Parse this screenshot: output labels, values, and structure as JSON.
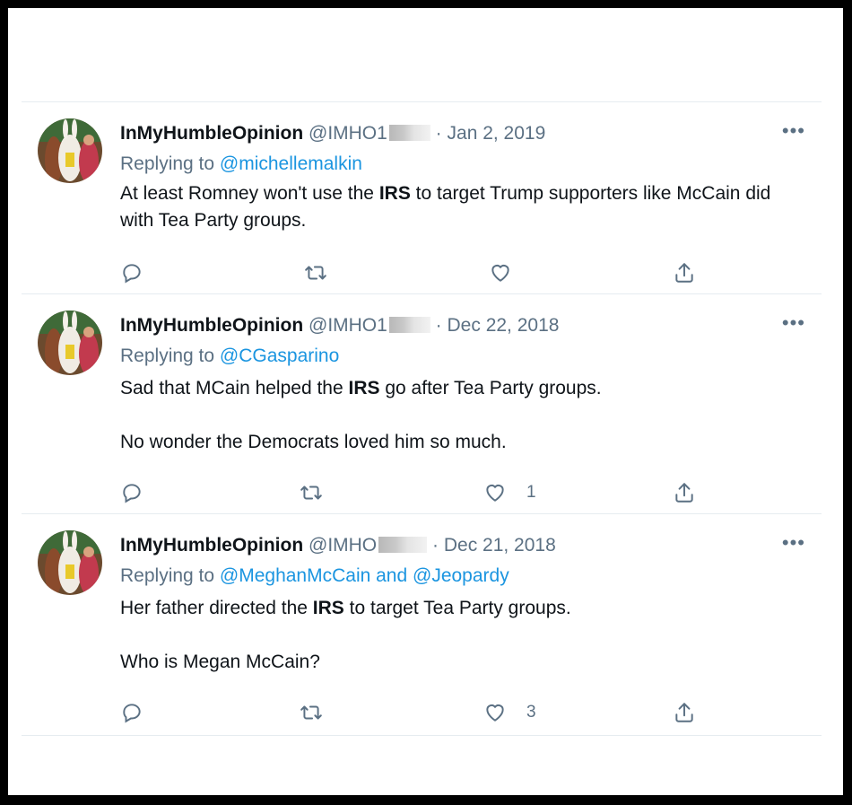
{
  "tweets": [
    {
      "name": "InMyHumbleOpinion",
      "handle": "@IMHO1",
      "separator": "·",
      "date": "Jan 2, 2019",
      "replying_prefix": "Replying to",
      "replying_to": "@michellemalkin",
      "body": [
        {
          "pre": "At least Romney won't use the ",
          "bold": "IRS",
          "post": " to target Trump supporters like McCain did with Tea Party groups."
        }
      ],
      "likes": ""
    },
    {
      "name": "InMyHumbleOpinion",
      "handle": "@IMHO1",
      "separator": "·",
      "date": "Dec 22, 2018",
      "replying_prefix": "Replying to",
      "replying_to": "@CGasparino",
      "body": [
        {
          "pre": "Sad that MCain helped the ",
          "bold": "IRS",
          "post": " go after Tea Party groups."
        },
        {
          "pre": "No wonder the Democrats loved him so much.",
          "bold": "",
          "post": ""
        }
      ],
      "likes": "1"
    },
    {
      "name": "InMyHumbleOpinion",
      "handle": "@IMHO",
      "separator": "·",
      "date": "Dec 21, 2018",
      "replying_prefix": "Replying to",
      "replying_to": "@MeghanMcCain and @Jeopardy",
      "body": [
        {
          "pre": "Her father directed the ",
          "bold": "IRS",
          "post": " to target Tea Party groups."
        },
        {
          "pre": "Who is Megan McCain?",
          "bold": "",
          "post": ""
        }
      ],
      "likes": "3"
    }
  ],
  "more_label": "•••",
  "icons": {
    "more": "more-options-icon",
    "reply": "reply-icon",
    "retweet": "retweet-icon",
    "like": "like-icon",
    "share": "share-icon"
  },
  "colors": {
    "text": "#0f1419",
    "secondary": "#5b7083",
    "link": "#1b95e0",
    "divider": "#e6ecf0"
  }
}
